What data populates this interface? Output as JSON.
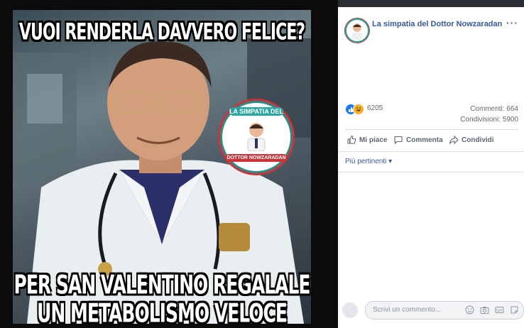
{
  "photo": {
    "caption_top": "VUOI RENDERLA DAVVERO FELICE?",
    "caption_bottom_line1": "PER SAN VALENTINO REGALALE",
    "caption_bottom_line2": "UN METABOLISMO VELOCE",
    "badge_top": "LA SIMPATIA DEL",
    "badge_bottom": "DOTTOR NOWZARADAN"
  },
  "post": {
    "page_name": "La simpatia del Dottor Nowzaradan",
    "more_label": "···",
    "reaction_count": "6205",
    "comments_label": "Commenti: 664",
    "shares_label": "Condivisioni: 5900"
  },
  "actions": {
    "like_label": "Mi piace",
    "comment_label": "Commenta",
    "share_label": "Condividi"
  },
  "sort": {
    "label": "Più pertinenti ▾"
  },
  "composer": {
    "placeholder": "Scrivi un commento..."
  },
  "colors": {
    "brand_blue": "#385898",
    "like_blue": "#1877f2",
    "haha_yellow": "#f7b125",
    "badge_teal": "#2aa5a0",
    "badge_red": "#c8353b"
  }
}
